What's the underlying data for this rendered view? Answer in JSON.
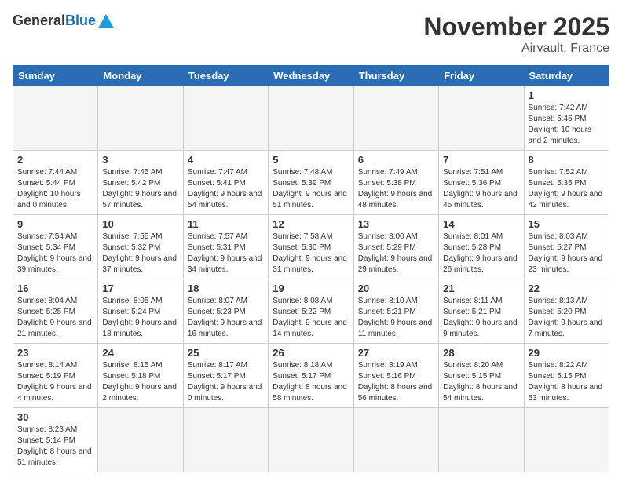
{
  "logo": {
    "general": "General",
    "blue": "Blue"
  },
  "title": {
    "month_year": "November 2025",
    "location": "Airvault, France"
  },
  "weekdays": [
    "Sunday",
    "Monday",
    "Tuesday",
    "Wednesday",
    "Thursday",
    "Friday",
    "Saturday"
  ],
  "weeks": [
    [
      {
        "day": "",
        "info": ""
      },
      {
        "day": "",
        "info": ""
      },
      {
        "day": "",
        "info": ""
      },
      {
        "day": "",
        "info": ""
      },
      {
        "day": "",
        "info": ""
      },
      {
        "day": "",
        "info": ""
      },
      {
        "day": "1",
        "info": "Sunrise: 7:42 AM\nSunset: 5:45 PM\nDaylight: 10 hours and 2 minutes."
      }
    ],
    [
      {
        "day": "2",
        "info": "Sunrise: 7:44 AM\nSunset: 5:44 PM\nDaylight: 10 hours and 0 minutes."
      },
      {
        "day": "3",
        "info": "Sunrise: 7:45 AM\nSunset: 5:42 PM\nDaylight: 9 hours and 57 minutes."
      },
      {
        "day": "4",
        "info": "Sunrise: 7:47 AM\nSunset: 5:41 PM\nDaylight: 9 hours and 54 minutes."
      },
      {
        "day": "5",
        "info": "Sunrise: 7:48 AM\nSunset: 5:39 PM\nDaylight: 9 hours and 51 minutes."
      },
      {
        "day": "6",
        "info": "Sunrise: 7:49 AM\nSunset: 5:38 PM\nDaylight: 9 hours and 48 minutes."
      },
      {
        "day": "7",
        "info": "Sunrise: 7:51 AM\nSunset: 5:36 PM\nDaylight: 9 hours and 45 minutes."
      },
      {
        "day": "8",
        "info": "Sunrise: 7:52 AM\nSunset: 5:35 PM\nDaylight: 9 hours and 42 minutes."
      }
    ],
    [
      {
        "day": "9",
        "info": "Sunrise: 7:54 AM\nSunset: 5:34 PM\nDaylight: 9 hours and 39 minutes."
      },
      {
        "day": "10",
        "info": "Sunrise: 7:55 AM\nSunset: 5:32 PM\nDaylight: 9 hours and 37 minutes."
      },
      {
        "day": "11",
        "info": "Sunrise: 7:57 AM\nSunset: 5:31 PM\nDaylight: 9 hours and 34 minutes."
      },
      {
        "day": "12",
        "info": "Sunrise: 7:58 AM\nSunset: 5:30 PM\nDaylight: 9 hours and 31 minutes."
      },
      {
        "day": "13",
        "info": "Sunrise: 8:00 AM\nSunset: 5:29 PM\nDaylight: 9 hours and 29 minutes."
      },
      {
        "day": "14",
        "info": "Sunrise: 8:01 AM\nSunset: 5:28 PM\nDaylight: 9 hours and 26 minutes."
      },
      {
        "day": "15",
        "info": "Sunrise: 8:03 AM\nSunset: 5:27 PM\nDaylight: 9 hours and 23 minutes."
      }
    ],
    [
      {
        "day": "16",
        "info": "Sunrise: 8:04 AM\nSunset: 5:25 PM\nDaylight: 9 hours and 21 minutes."
      },
      {
        "day": "17",
        "info": "Sunrise: 8:05 AM\nSunset: 5:24 PM\nDaylight: 9 hours and 18 minutes."
      },
      {
        "day": "18",
        "info": "Sunrise: 8:07 AM\nSunset: 5:23 PM\nDaylight: 9 hours and 16 minutes."
      },
      {
        "day": "19",
        "info": "Sunrise: 8:08 AM\nSunset: 5:22 PM\nDaylight: 9 hours and 14 minutes."
      },
      {
        "day": "20",
        "info": "Sunrise: 8:10 AM\nSunset: 5:21 PM\nDaylight: 9 hours and 11 minutes."
      },
      {
        "day": "21",
        "info": "Sunrise: 8:11 AM\nSunset: 5:21 PM\nDaylight: 9 hours and 9 minutes."
      },
      {
        "day": "22",
        "info": "Sunrise: 8:13 AM\nSunset: 5:20 PM\nDaylight: 9 hours and 7 minutes."
      }
    ],
    [
      {
        "day": "23",
        "info": "Sunrise: 8:14 AM\nSunset: 5:19 PM\nDaylight: 9 hours and 4 minutes."
      },
      {
        "day": "24",
        "info": "Sunrise: 8:15 AM\nSunset: 5:18 PM\nDaylight: 9 hours and 2 minutes."
      },
      {
        "day": "25",
        "info": "Sunrise: 8:17 AM\nSunset: 5:17 PM\nDaylight: 9 hours and 0 minutes."
      },
      {
        "day": "26",
        "info": "Sunrise: 8:18 AM\nSunset: 5:17 PM\nDaylight: 8 hours and 58 minutes."
      },
      {
        "day": "27",
        "info": "Sunrise: 8:19 AM\nSunset: 5:16 PM\nDaylight: 8 hours and 56 minutes."
      },
      {
        "day": "28",
        "info": "Sunrise: 8:20 AM\nSunset: 5:15 PM\nDaylight: 8 hours and 54 minutes."
      },
      {
        "day": "29",
        "info": "Sunrise: 8:22 AM\nSunset: 5:15 PM\nDaylight: 8 hours and 53 minutes."
      }
    ],
    [
      {
        "day": "30",
        "info": "Sunrise: 8:23 AM\nSunset: 5:14 PM\nDaylight: 8 hours and 51 minutes."
      },
      {
        "day": "",
        "info": ""
      },
      {
        "day": "",
        "info": ""
      },
      {
        "day": "",
        "info": ""
      },
      {
        "day": "",
        "info": ""
      },
      {
        "day": "",
        "info": ""
      },
      {
        "day": "",
        "info": ""
      }
    ]
  ]
}
